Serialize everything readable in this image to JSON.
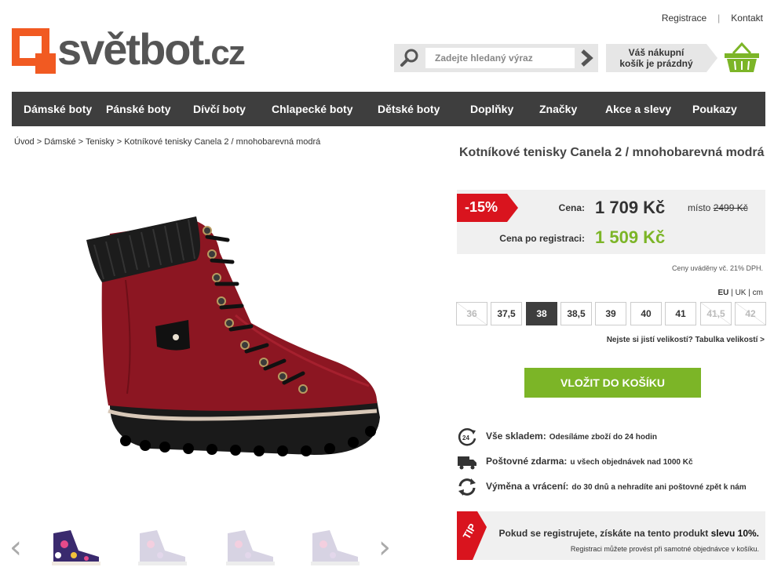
{
  "toplinks": {
    "register": "Registrace",
    "separator": "|",
    "contact": "Kontakt"
  },
  "logo": {
    "name": "světbot",
    "tld": ".cz",
    "icon": "orange-square-logo"
  },
  "search": {
    "placeholder": "Zadejte hledaný výraz",
    "icon": "search-icon",
    "submit_icon": "chevron-right-icon"
  },
  "cart": {
    "line1": "Váš nákupní",
    "line2": "košík je prázdný",
    "icon": "basket-icon",
    "color": "#7cb527"
  },
  "nav": {
    "items": [
      "Dámské boty",
      "Pánské boty",
      "Dívčí boty",
      "Chlapecké boty",
      "Dětské boty",
      "Doplňky",
      "Značky",
      "Akce a slevy",
      "Poukazy"
    ]
  },
  "breadcrumb": {
    "items": [
      "Úvod",
      "Dámské",
      "Tenisky",
      "Kotníkové tenisky Canela 2 / mnohobarevná modrá"
    ],
    "sep": ">"
  },
  "product": {
    "title": "Kotníkové tenisky Canela 2 / mnohobarevná modrá",
    "discount": "-15%",
    "price_label": "Cena:",
    "price": "1 709 Kč",
    "old_prefix": "místo",
    "old_price": "2499 Kč",
    "reg_label": "Cena po registraci:",
    "reg_price": "1 509 Kč",
    "vat_note": "Ceny uváděny vč. 21% DPH."
  },
  "sizes": {
    "units": {
      "eu": "EU",
      "uk": "UK",
      "cm": "cm",
      "sep": "|"
    },
    "items": [
      {
        "label": "36",
        "state": "disabled"
      },
      {
        "label": "37,5",
        "state": "available"
      },
      {
        "label": "38",
        "state": "selected"
      },
      {
        "label": "38,5",
        "state": "available"
      },
      {
        "label": "39",
        "state": "available"
      },
      {
        "label": "40",
        "state": "available"
      },
      {
        "label": "41",
        "state": "available"
      },
      {
        "label": "41,5",
        "state": "disabled"
      },
      {
        "label": "42",
        "state": "disabled"
      }
    ],
    "help": "Nejste si jistí velikostí? Tabulka velikostí >"
  },
  "add_to_cart": "VLOŽIT DO KOŠÍKU",
  "features": [
    {
      "icon": "24h-clock-icon",
      "title": "Vše skladem:",
      "text": "Odesíláme zboží do 24 hodin"
    },
    {
      "icon": "truck-icon",
      "title": "Poštovné zdarma:",
      "text": "u všech objednávek nad 1000 Kč"
    },
    {
      "icon": "exchange-arrows-icon",
      "title": "Výměna a vrácení:",
      "text": "do 30 dnů a nehradíte ani poštovné zpět k nám"
    }
  ],
  "tip": {
    "flag": "TIP",
    "main_pre": "Pokud se registrujete, získáte na tento produkt",
    "main_bold": "slevu 10%.",
    "sub": "Registraci můžete provést při samotné objednávce v košíku."
  },
  "colors": {
    "accent_green": "#7cb527",
    "badge_red": "#d9141e",
    "nav_bg": "#3e3e3e",
    "logo_orange": "#f15a22"
  }
}
